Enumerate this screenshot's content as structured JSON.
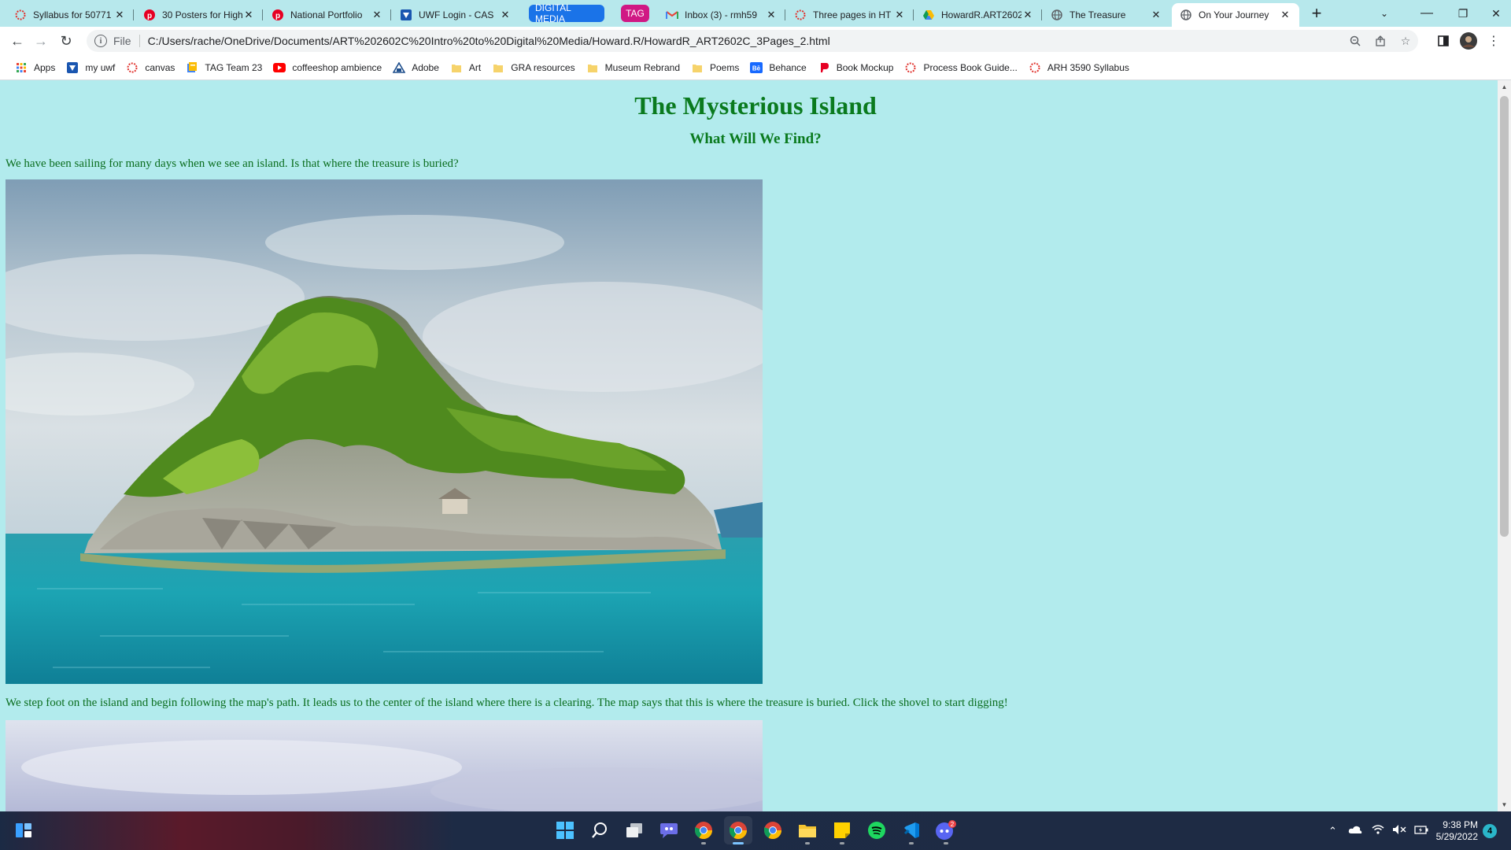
{
  "browser": {
    "tabs": [
      {
        "title": "Syllabus for 50771",
        "icon": "canvas-icon"
      },
      {
        "title": "30 Posters for High",
        "icon": "pinterest-icon"
      },
      {
        "title": "National Portfolio",
        "icon": "pinterest-icon"
      },
      {
        "title": "UWF Login - CAS",
        "icon": "uwf-icon"
      },
      {
        "title": "The Treasure",
        "icon": "globe-icon"
      },
      {
        "title": "On Your Journey",
        "icon": "globe-icon"
      }
    ],
    "group_digital_media": {
      "label": "DIGITAL MEDIA",
      "color": "#1a73e8"
    },
    "group_tag": {
      "label": "TAG",
      "color": "#d01884"
    },
    "group_tabs": [
      {
        "title": "Inbox (3) - rmh59",
        "icon": "gmail-icon"
      },
      {
        "title": "Three pages in HT",
        "icon": "canvas-icon"
      },
      {
        "title": "HowardR.ART2602",
        "icon": "drive-icon"
      }
    ],
    "new_tab": "+",
    "address": {
      "scheme": "File",
      "url": "C:/Users/rache/OneDrive/Documents/ART%202602C%20Intro%20to%20Digital%20Media/Howard.R/HowardR_ART2602C_3Pages_2.html"
    },
    "bookmarks": [
      {
        "label": "Apps",
        "icon": "apps-grid-icon",
        "color": "#ea4335"
      },
      {
        "label": "my uwf",
        "icon": "uwf-icon",
        "color": "#1a56b0"
      },
      {
        "label": "canvas",
        "icon": "canvas-icon",
        "color": "#e0322d"
      },
      {
        "label": "TAG Team 23",
        "icon": "document-icon",
        "color": "#4285f4"
      },
      {
        "label": "coffeeshop ambience",
        "icon": "youtube-icon",
        "color": "#ff0000"
      },
      {
        "label": "Adobe",
        "icon": "adobe-icon",
        "color": "#1e4e8c"
      },
      {
        "label": "Art",
        "icon": "folder-icon",
        "color": "#f6d36b"
      },
      {
        "label": "GRA resources",
        "icon": "folder-icon",
        "color": "#f6d36b"
      },
      {
        "label": "Museum Rebrand",
        "icon": "folder-icon",
        "color": "#f6d36b"
      },
      {
        "label": "Poems",
        "icon": "folder-icon",
        "color": "#f6d36b"
      },
      {
        "label": "Behance",
        "icon": "behance-icon",
        "color": "#1769ff"
      },
      {
        "label": "Book Mockup",
        "icon": "pinterest-icon",
        "color": "#e60023"
      },
      {
        "label": "Process Book Guide...",
        "icon": "canvas-icon",
        "color": "#e0322d"
      },
      {
        "label": "ARH 3590 Syllabus",
        "icon": "canvas-icon",
        "color": "#e0322d"
      }
    ]
  },
  "page": {
    "title": "The Mysterious Island",
    "subtitle": "What Will We Find?",
    "paragraph1": "We have been sailing for many days when we see an island. Is that where the treasure is buried?",
    "paragraph2": "We step foot on the island and begin following the map's path. It leads us to the center of the island where there is a clearing. The map says that this is where the treasure is buried. Click the shovel to start digging!",
    "background_color": "#b2ebed",
    "text_color": "#0a7a1e"
  },
  "taskbar": {
    "apps": [
      "windows-start-icon",
      "search-icon",
      "task-view-icon",
      "teams-chat-icon",
      "chrome-icon",
      "chrome-icon",
      "chrome-icon",
      "file-explorer-icon",
      "sticky-notes-icon",
      "spotify-icon",
      "vscode-icon",
      "discord-icon"
    ],
    "discord_badge": "2",
    "time": "9:38 PM",
    "date": "5/29/2022",
    "notification_count": "4"
  }
}
